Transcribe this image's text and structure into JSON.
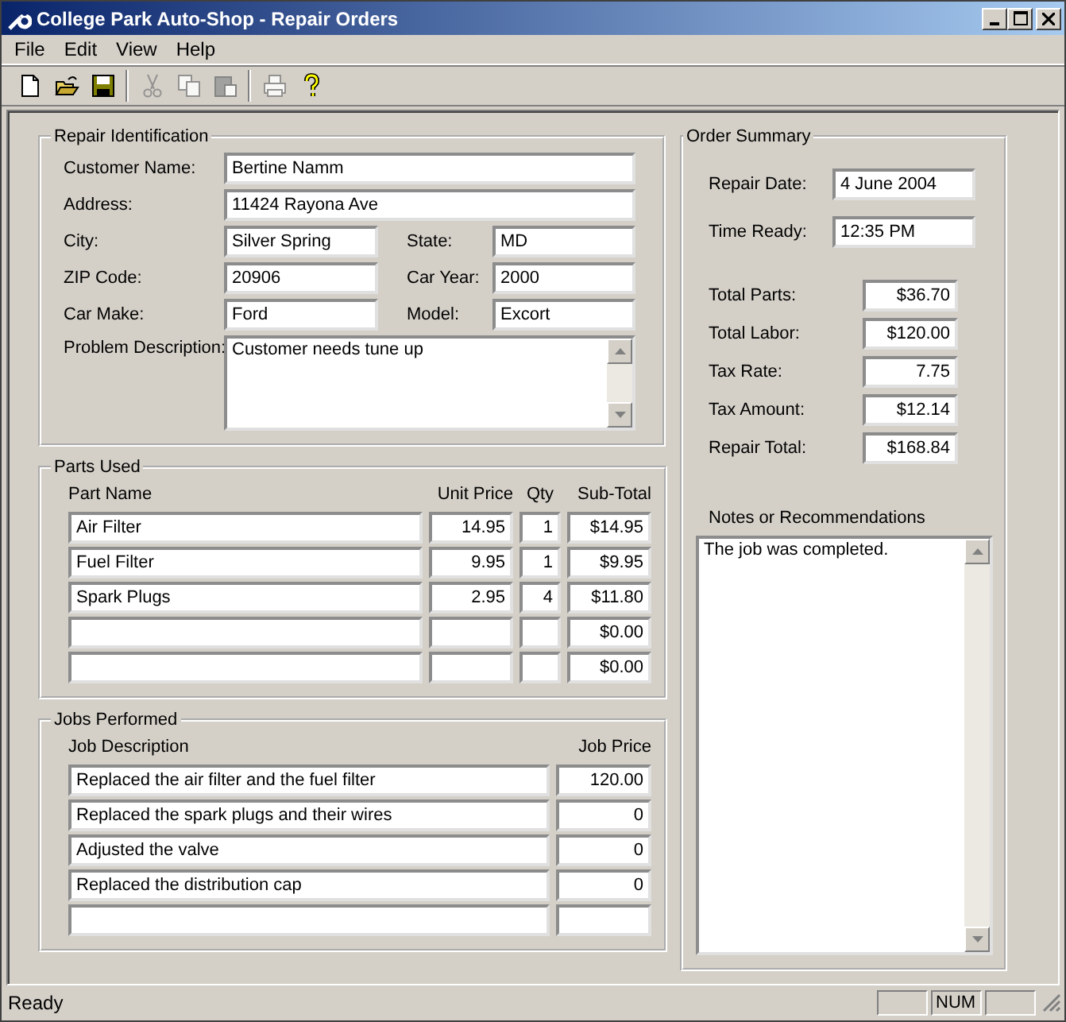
{
  "window": {
    "title": "College Park Auto-Shop - Repair Orders"
  },
  "menu": [
    "File",
    "Edit",
    "View",
    "Help"
  ],
  "toolbar": [
    [
      {
        "kind": "new",
        "disabled": false
      },
      {
        "kind": "open",
        "disabled": false
      },
      {
        "kind": "save",
        "disabled": false
      }
    ],
    [
      {
        "kind": "cut",
        "disabled": true
      },
      {
        "kind": "copy",
        "disabled": true
      },
      {
        "kind": "paste",
        "disabled": true
      }
    ],
    [
      {
        "kind": "print",
        "disabled": true
      },
      {
        "kind": "help",
        "disabled": false
      }
    ]
  ],
  "repair_identification": {
    "title": "Repair Identification",
    "customer_name": {
      "label": "Customer Name:",
      "value": "Bertine Namm"
    },
    "address": {
      "label": "Address:",
      "value": "11424 Rayona Ave"
    },
    "city": {
      "label": "City:",
      "value": "Silver Spring"
    },
    "state": {
      "label": "State:",
      "value": "MD"
    },
    "zip_code": {
      "label": "ZIP Code:",
      "value": "20906"
    },
    "car_year": {
      "label": "Car Year:",
      "value": "2000"
    },
    "car_make": {
      "label": "Car Make:",
      "value": "Ford"
    },
    "model": {
      "label": "Model:",
      "value": "Excort"
    },
    "problem_description": {
      "label": "Problem Description:",
      "value": "Customer needs tune up"
    }
  },
  "parts_used": {
    "title": "Parts Used",
    "columns": [
      "Part Name",
      "Unit Price",
      "Qty",
      "Sub-Total"
    ],
    "rows": [
      {
        "part_name": "Air Filter",
        "unit_price": "14.95",
        "qty": "1",
        "sub_total": "$14.95"
      },
      {
        "part_name": "Fuel Filter",
        "unit_price": "9.95",
        "qty": "1",
        "sub_total": "$9.95"
      },
      {
        "part_name": "Spark Plugs",
        "unit_price": "2.95",
        "qty": "4",
        "sub_total": "$11.80"
      },
      {
        "sub_total": "$0.00"
      },
      {
        "sub_total": "$0.00"
      }
    ]
  },
  "jobs_performed": {
    "title": "Jobs Performed",
    "columns": [
      "Job Description",
      "Job Price"
    ],
    "rows": [
      {
        "description": "Replaced the air filter and the fuel filter",
        "price": "120.00"
      },
      {
        "description": "Replaced the spark plugs and their wires",
        "price": "0"
      },
      {
        "description": "Adjusted the valve",
        "price": "0"
      },
      {
        "description": "Replaced the distribution cap",
        "price": "0"
      },
      {}
    ]
  },
  "order_summary": {
    "title": "Order Summary",
    "repair_date": {
      "label": "Repair Date:",
      "value": "4 June 2004"
    },
    "time_ready": {
      "label": "Time Ready:",
      "value": "12:35 PM"
    },
    "totals": [
      {
        "label": "Total Parts:",
        "value": "$36.70"
      },
      {
        "label": "Total Labor:",
        "value": "$120.00"
      },
      {
        "label": "Tax Rate:",
        "value": "7.75"
      },
      {
        "label": "Tax Amount:",
        "value": "$12.14"
      },
      {
        "label": "Repair Total:",
        "value": "$168.84"
      }
    ],
    "notes": {
      "label": "Notes or Recommendations",
      "value": "The job was completed."
    }
  },
  "status_bar": {
    "text": "Ready",
    "num_indicator": "NUM"
  }
}
